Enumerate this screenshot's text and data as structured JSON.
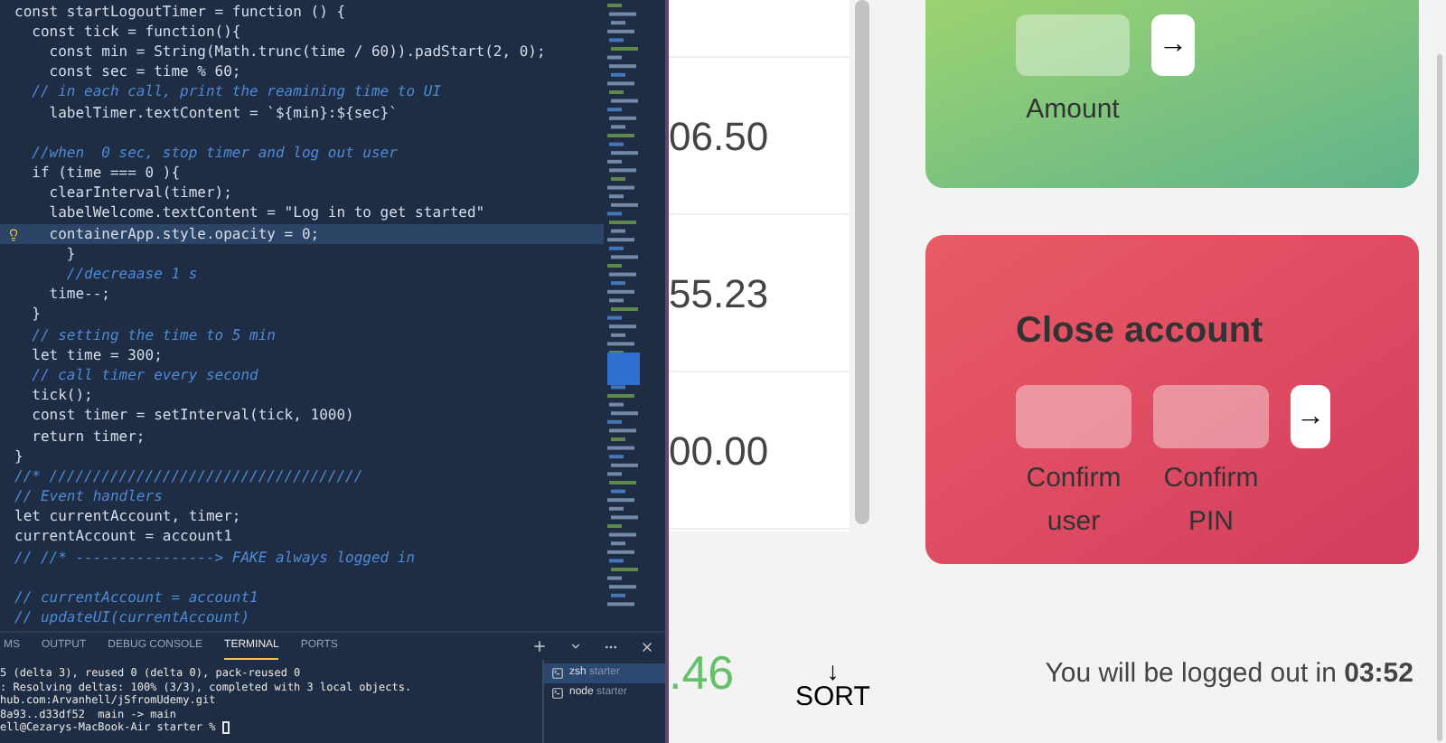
{
  "editor": {
    "lines": [
      {
        "text": "const startLogoutTimer = function () {",
        "kind": "code",
        "current": false
      },
      {
        "text": "  const tick = function(){",
        "kind": "code",
        "current": false
      },
      {
        "text": "    const min = String(Math.trunc(time / 60)).padStart(2, 0);",
        "kind": "code",
        "current": false
      },
      {
        "text": "    const sec = time % 60;",
        "kind": "code",
        "current": false
      },
      {
        "text": "  // in each call, print the reamining time to UI",
        "kind": "comment",
        "current": false
      },
      {
        "text": "    labelTimer.textContent = `${min}:${sec}`",
        "kind": "code",
        "current": false
      },
      {
        "kind": "blank",
        "current": false
      },
      {
        "text": "  //when  0 sec, stop timer and log out user",
        "kind": "comment",
        "current": false
      },
      {
        "text": "  if (time === 0 ){",
        "kind": "code",
        "current": false
      },
      {
        "text": "    clearInterval(timer);",
        "kind": "code",
        "current": false
      },
      {
        "text": "    labelWelcome.textContent = \"Log in to get started\"",
        "kind": "code",
        "current": false
      },
      {
        "text": "    containerApp.style.opacity = 0;",
        "kind": "code",
        "current": true
      },
      {
        "text": "      }",
        "kind": "code",
        "current": false
      },
      {
        "text": "      //decreaase 1 s",
        "kind": "comment",
        "current": false
      },
      {
        "text": "    time--;",
        "kind": "code",
        "current": false
      },
      {
        "text": "  }",
        "kind": "code",
        "current": false
      },
      {
        "text": "  // setting the time to 5 min",
        "kind": "comment",
        "current": false
      },
      {
        "text": "  let time = 300;",
        "kind": "code",
        "current": false
      },
      {
        "text": "  // call timer every second",
        "kind": "comment",
        "current": false
      },
      {
        "text": "  tick();",
        "kind": "code",
        "current": false
      },
      {
        "text": "  const timer = setInterval(tick, 1000)",
        "kind": "code",
        "current": false
      },
      {
        "text": "  return timer;",
        "kind": "code",
        "current": false
      },
      {
        "text": "}",
        "kind": "code",
        "current": false
      },
      {
        "text": "//* ////////////////////////////////////",
        "kind": "comment",
        "current": false
      },
      {
        "text": "// Event handlers",
        "kind": "comment",
        "current": false
      },
      {
        "text": "let currentAccount, timer;",
        "kind": "code",
        "current": false
      },
      {
        "text": "currentAccount = account1",
        "kind": "code",
        "current": false
      },
      {
        "text": "// //* ----------------> FAKE always logged in",
        "kind": "comment",
        "current": false
      },
      {
        "kind": "blank",
        "current": false
      },
      {
        "text": "// currentAccount = account1",
        "kind": "comment",
        "current": false
      },
      {
        "text": "// updateUI(currentAccount)",
        "kind": "comment",
        "current": false
      }
    ]
  },
  "panel": {
    "tabs": [
      {
        "label": "MS",
        "selected": false
      },
      {
        "label": "OUTPUT",
        "selected": false
      },
      {
        "label": "DEBUG CONSOLE",
        "selected": false
      },
      {
        "label": "TERMINAL",
        "selected": true
      },
      {
        "label": "PORTS",
        "selected": false
      }
    ],
    "terminal_lines": [
      "5 (delta 3), reused 0 (delta 0), pack-reused 0",
      ": Resolving deltas: 100% (3/3), completed with 3 local objects.",
      "hub.com:Arvanhell/jSfromUdemy.git",
      "8a93..d33df52  main -> main",
      "ell@Cezarys-MacBook-Air starter % "
    ],
    "terminals": [
      {
        "name": "zsh",
        "folder": "starter",
        "selected": true
      },
      {
        "name": "node",
        "folder": "starter",
        "selected": false
      }
    ]
  },
  "app": {
    "movements": [
      "06.50",
      "55.23",
      "00.00"
    ],
    "loan_card": {
      "label": "Amount",
      "button": "→"
    },
    "close_card": {
      "title": "Close account",
      "fields": [
        "Confirm user",
        "Confirm PIN"
      ],
      "button": "→"
    },
    "balance_sum": ".46",
    "sort": {
      "arrow": "↓",
      "label": "SORT"
    },
    "logout_timer": "You will be logged out in **03:52**"
  }
}
